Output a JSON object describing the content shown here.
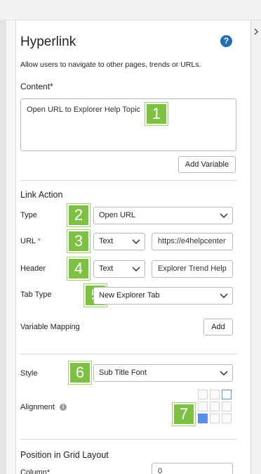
{
  "panel": {
    "title": "Hyperlink",
    "help_icon": "question-circle-icon",
    "description": "Allow users to navigate to other pages, trends or URLs."
  },
  "content": {
    "label": "Content",
    "required_marker": "*",
    "value": "Open URL to Explorer Help Topic",
    "add_variable_label": "Add Variable"
  },
  "link_action": {
    "section_label": "Link Action",
    "type": {
      "label": "Type",
      "value": "Open URL"
    },
    "url": {
      "label": "URL",
      "required_marker": "*",
      "mode": "Text",
      "value": "https://e4helpcenter"
    },
    "header": {
      "label": "Header",
      "mode": "Text",
      "value": "Explorer Trend Help"
    },
    "tab_type": {
      "label": "Tab Type",
      "value": "New Explorer Tab"
    },
    "variable_mapping": {
      "label": "Variable Mapping",
      "add_label": "Add"
    }
  },
  "style": {
    "label": "Style",
    "value": "Sub Title Font",
    "alignment_label": "Alignment",
    "alignment_selected": "bottom-left",
    "info_icon": "info-circle-icon"
  },
  "position": {
    "section_label": "Position in Grid Layout",
    "column_label": "Column*",
    "column_value": "0"
  },
  "badges": [
    "1",
    "2",
    "3",
    "4",
    "5",
    "6",
    "7"
  ],
  "colors": {
    "badge": "#7dc142",
    "accent": "#1e6fb5",
    "required": "#d9302c",
    "alignment_selected": "#5b8fe6"
  }
}
